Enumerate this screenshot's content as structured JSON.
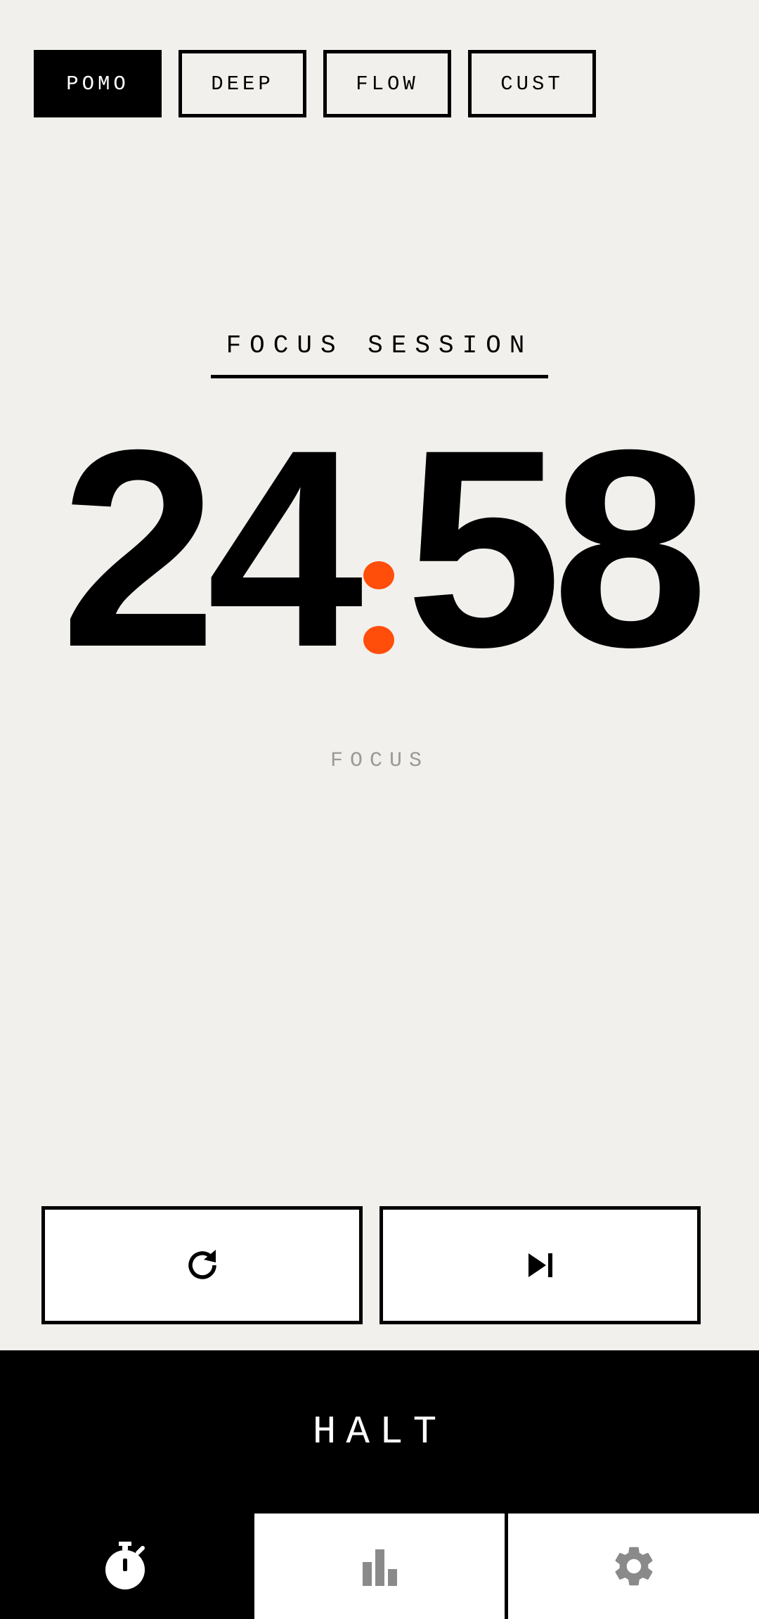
{
  "mode_tabs": [
    {
      "label": "POMO",
      "active": true
    },
    {
      "label": "DEEP",
      "active": false
    },
    {
      "label": "FLOW",
      "active": false
    },
    {
      "label": "CUST",
      "active": false
    }
  ],
  "session": {
    "label": "FOCUS SESSION"
  },
  "timer": {
    "minutes": "24",
    "seconds": "58",
    "accent_color": "#ff4d0a"
  },
  "phase": {
    "label": "FOCUS"
  },
  "controls": {
    "reset_icon": "reset-icon",
    "skip_icon": "skip-next-icon"
  },
  "halt": {
    "label": "HALT"
  },
  "bottom_nav": [
    {
      "icon": "stopwatch-icon",
      "active": true
    },
    {
      "icon": "bar-chart-icon",
      "active": false
    },
    {
      "icon": "gear-icon",
      "active": false
    }
  ]
}
